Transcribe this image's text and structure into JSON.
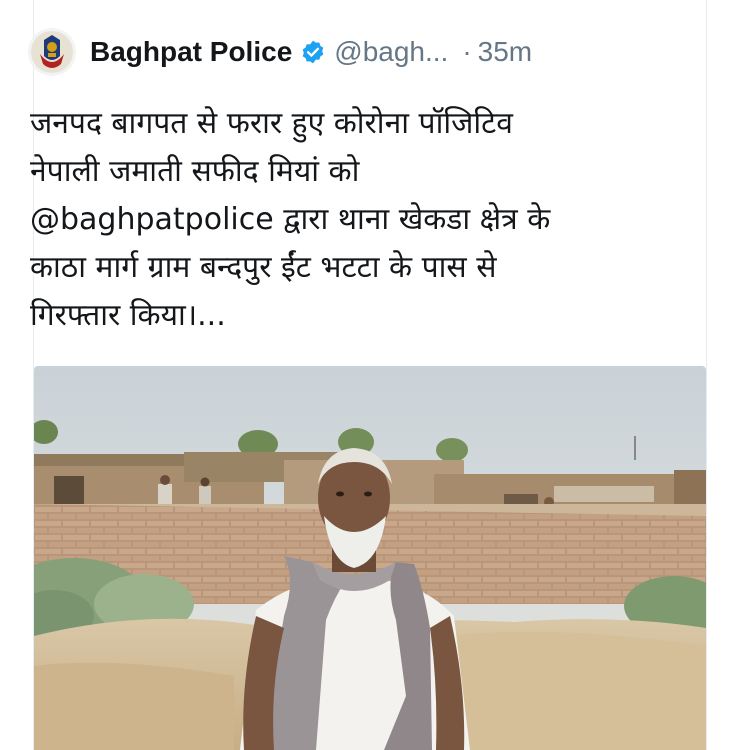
{
  "author": {
    "name": "Baghpat Police",
    "handle": "@bagh...",
    "separator": "·",
    "time": "35m",
    "verified": true
  },
  "tweet": {
    "lines": [
      "जनपद बागपत से फरार हुए कोरोना पॉजिटिव",
      "नेपाली जमाती सफीद मियां को",
      "@baghpatpolice द्वारा थाना खेकडा क्षेत्र के",
      "काठा मार्ग ग्राम बन्दपुर ईंट भटटा के पास से",
      "गिरफ्तार किया।..."
    ]
  },
  "colors": {
    "text": "#14171a",
    "secondary": "#657786",
    "verified_badge": "#1da1f2"
  },
  "icons": {
    "avatar": "police-emblem-icon",
    "verified": "verified-badge-icon"
  },
  "media": {
    "type": "photo"
  }
}
